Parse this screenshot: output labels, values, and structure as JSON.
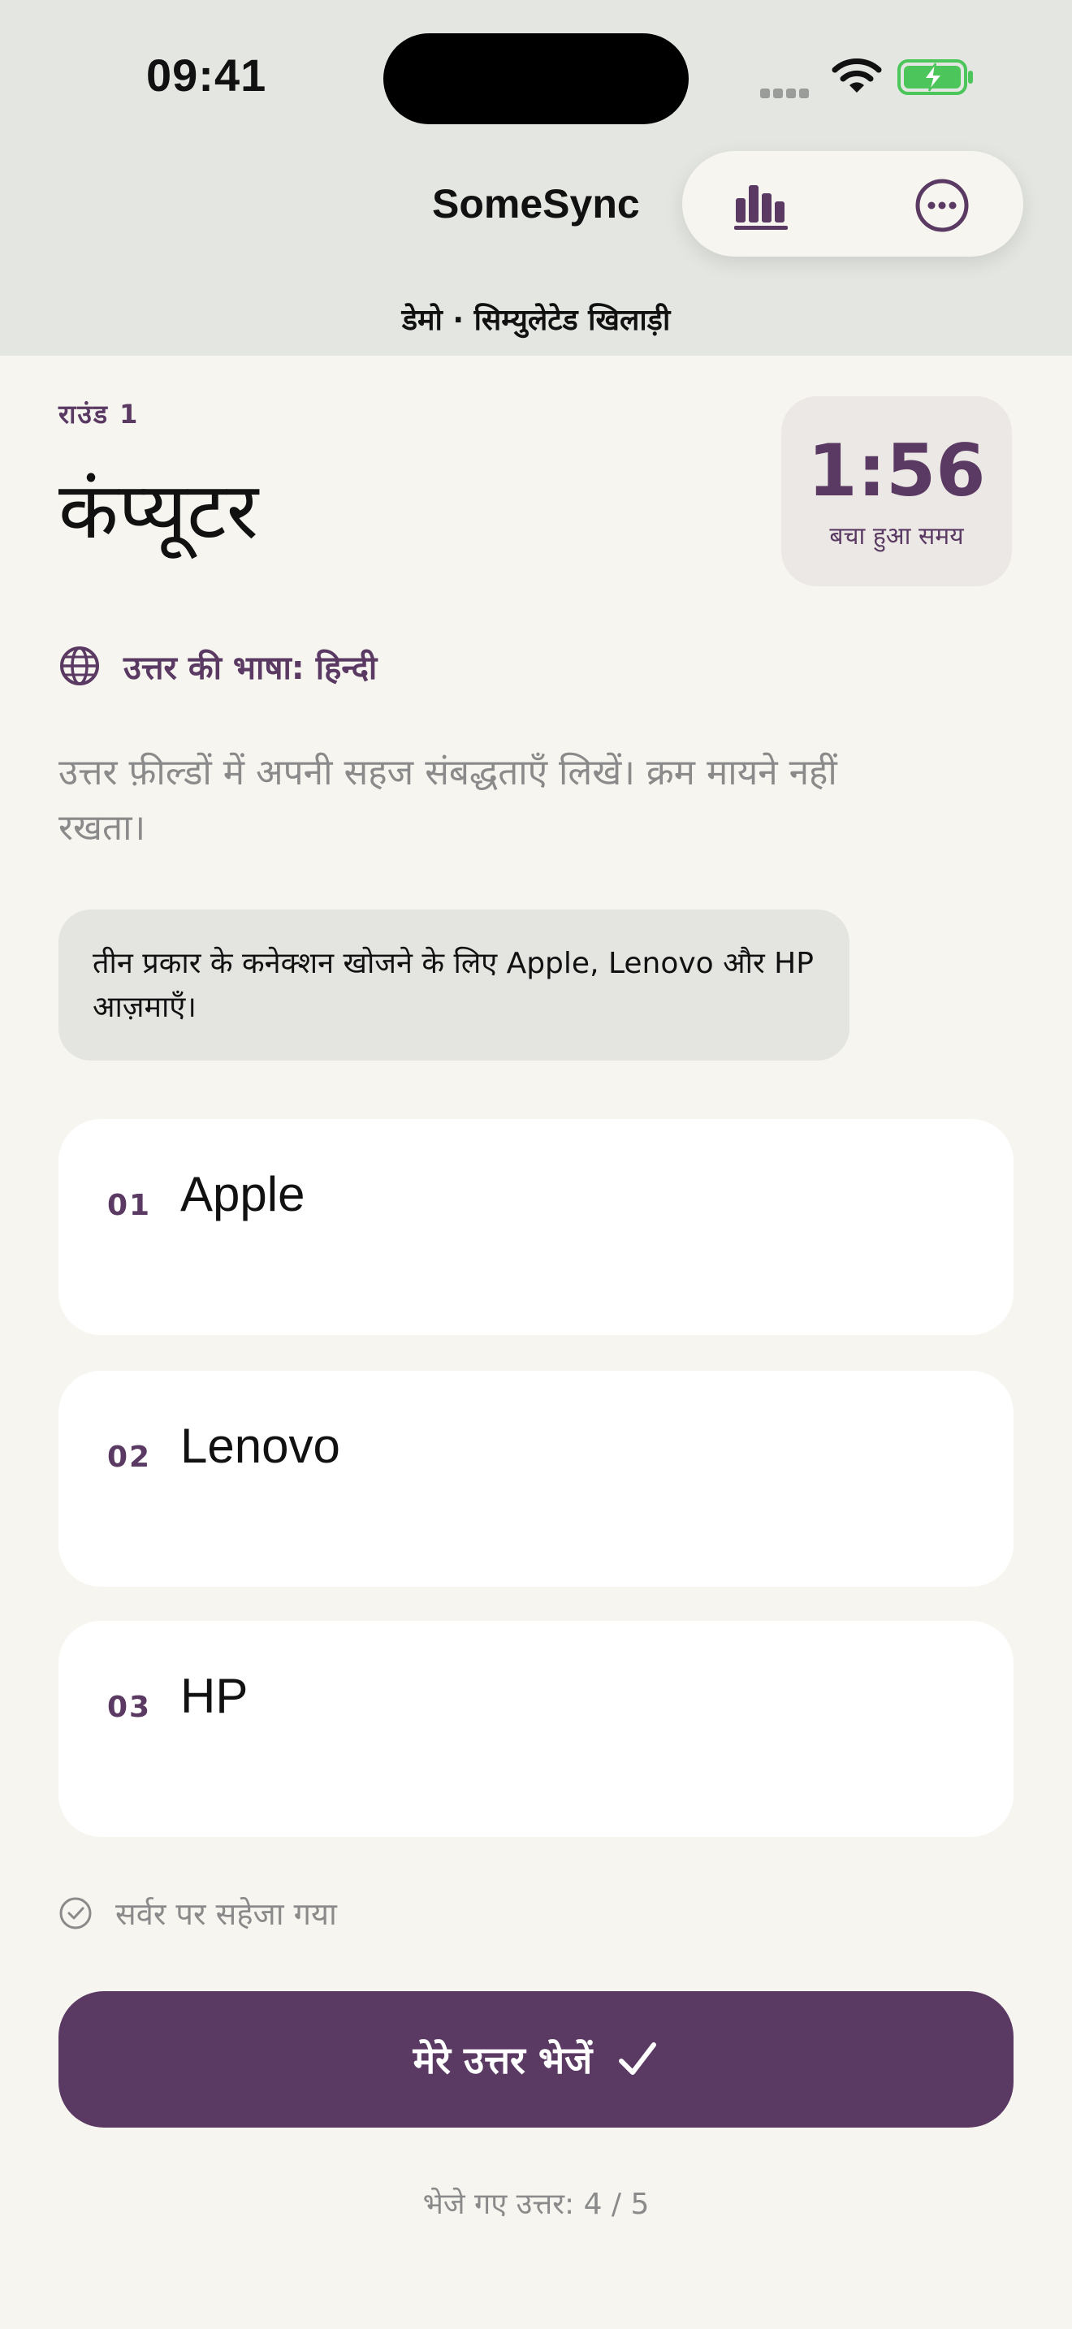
{
  "status_bar": {
    "time": "09:41",
    "icons": [
      "signal-dots-icon",
      "wifi-icon",
      "battery-charging-icon"
    ]
  },
  "header": {
    "app_title": "SomeSync",
    "subtitle": "डेमो · सिम्युलेटेड खिलाड़ी",
    "toolbar": [
      "stats-icon",
      "more-icon"
    ]
  },
  "round": {
    "label": "राउंड 1",
    "category": "कंप्यूटर",
    "timer": {
      "value": "1:56",
      "label": "बचा हुआ समय"
    }
  },
  "language": {
    "label": "उत्तर की भाषा: हिन्दी",
    "icon": "globe-icon"
  },
  "instructions": "उत्तर फ़ील्डों में अपनी सहज संबद्धताएँ लिखें। क्रम मायने नहीं रखता।",
  "hint": "तीन प्रकार के कनेक्शन खोजने के लिए Apple, Lenovo और HP आज़माएँ।",
  "answers": [
    {
      "number": "01",
      "value": "Apple"
    },
    {
      "number": "02",
      "value": "Lenovo"
    },
    {
      "number": "03",
      "value": "HP"
    }
  ],
  "saved_status": "सर्वर पर सहेजा गया",
  "submit_label": "मेरे उत्तर भेजें",
  "sent_count": "भेजे गए उत्तर: 4 / 5",
  "colors": {
    "accent": "#5a3a63",
    "header_bg": "#e3e6e1",
    "page_bg": "#f7f5f0",
    "hint_bg": "#e4e5e0",
    "timer_bg": "#ece8e5",
    "battery_green": "#4cc65a"
  }
}
